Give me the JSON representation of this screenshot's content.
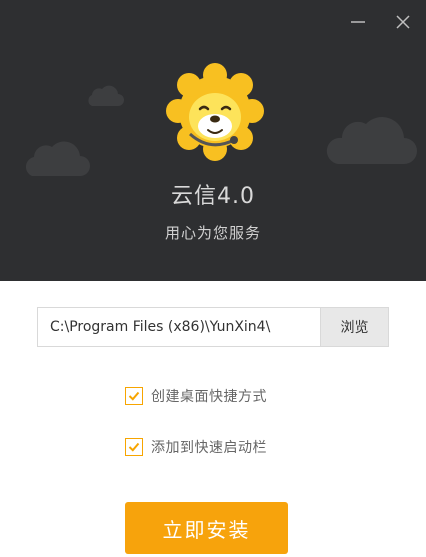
{
  "window": {
    "minimize_icon": "minimize-icon",
    "close_icon": "close-icon"
  },
  "app": {
    "title": "云信4.0",
    "slogan": "用心为您服务",
    "logo_icon": "lion-mascot-icon"
  },
  "install_path": {
    "value": "C:\\Program Files (x86)\\YunXin4\\",
    "browse_label": "浏览"
  },
  "options": [
    {
      "label": "创建桌面快捷方式",
      "checked": true
    },
    {
      "label": "添加到快速启动栏",
      "checked": true
    }
  ],
  "install_button": {
    "label": "立即安装"
  },
  "colors": {
    "header_bg": "#2e2f31",
    "accent": "#f7a30c",
    "checkbox_border": "#f7a500"
  }
}
